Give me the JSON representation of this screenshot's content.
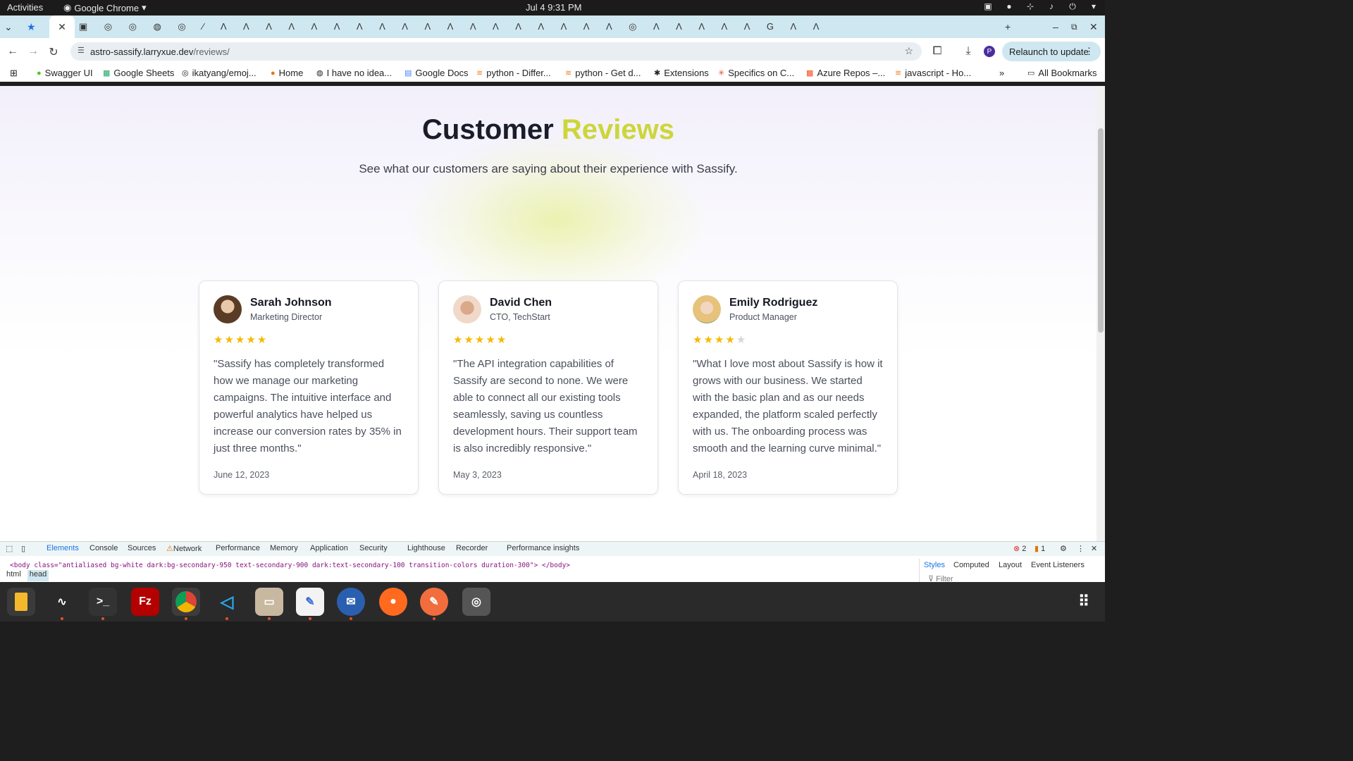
{
  "system": {
    "activities": "Activities",
    "app_name": "Google Chrome",
    "clock": "Jul 4  9:31 PM"
  },
  "browser": {
    "url_host": "astro-sassify.larryxue.dev",
    "url_path": "/reviews/",
    "relaunch_label": "Relaunch to update",
    "profile_initial": "P",
    "bookmarks": [
      "Swagger UI",
      "Google Sheets",
      "ikatyang/emoj...",
      "Home",
      "I have no idea...",
      "Google Docs",
      "python - Differ...",
      "python - Get d...",
      "Extensions",
      "Specifics on C...",
      "Azure Repos –...",
      "javascript - Ho..."
    ],
    "all_bookmarks": "All Bookmarks"
  },
  "page": {
    "title_main": "Customer",
    "title_accent": "Reviews",
    "accent_color": "#ccd63a",
    "subtitle": "See what our customers are saying about their experience with Sassify.",
    "reviews": [
      {
        "name": "Sarah Johnson",
        "role": "Marketing Director",
        "rating": 5,
        "quote": "\"Sassify has completely transformed how we manage our marketing campaigns. The intuitive interface and powerful analytics have helped us increase our conversion rates by 35% in just three months.\"",
        "date": "June 12, 2023"
      },
      {
        "name": "David Chen",
        "role": "CTO, TechStart",
        "rating": 5,
        "quote": "\"The API integration capabilities of Sassify are second to none. We were able to connect all our existing tools seamlessly, saving us countless development hours. Their support team is also incredibly responsive.\"",
        "date": "May 3, 2023"
      },
      {
        "name": "Emily Rodriguez",
        "role": "Product Manager",
        "rating": 4,
        "quote": "\"What I love most about Sassify is how it grows with our business. We started with the basic plan and as our needs expanded, the platform scaled perfectly with us. The onboarding process was smooth and the learning curve minimal.\"",
        "date": "April 18, 2023"
      }
    ]
  },
  "devtools": {
    "tabs": [
      "Elements",
      "Console",
      "Sources",
      "Network",
      "Performance",
      "Memory",
      "Application",
      "Security",
      "Lighthouse",
      "Recorder",
      "Performance insights"
    ],
    "body_line": "<body class=\"antialiased bg-white dark:bg-secondary-950 text-secondary-900 dark:text-secondary-100 transition-colors duration-300\"> </body>",
    "crumbs": [
      "html",
      "head"
    ],
    "side_tabs": [
      "Styles",
      "Computed",
      "Layout",
      "Event Listeners"
    ],
    "filter_placeholder": "Filter",
    "errors": "2",
    "warnings": "1"
  }
}
